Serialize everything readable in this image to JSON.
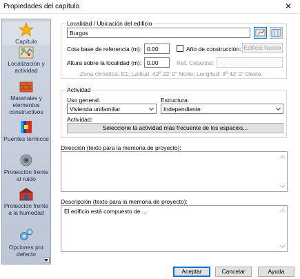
{
  "window": {
    "title": "Propiedades del capítulo",
    "close_symbol": "✕"
  },
  "sidebar": {
    "items": [
      {
        "label": "Capítulo",
        "icon": "star-icon"
      },
      {
        "label": "Localización y actividad",
        "icon": "map-icon"
      },
      {
        "label": "Materiales y elementos constructivos",
        "icon": "brick-icon"
      },
      {
        "label": "Puentes térmicos",
        "icon": "thermal-bridge-icon"
      },
      {
        "label": "Protección frente al ruido",
        "icon": "speaker-icon"
      },
      {
        "label": "Protección frente a la humedad",
        "icon": "humidity-icon"
      },
      {
        "label": "Opciones por defecto",
        "icon": "gears-icon"
      }
    ]
  },
  "location": {
    "legend": "Localidad / Ubicación del edificio",
    "city_value": "Burgos",
    "base_level_label": "Cota base de referencia (m):",
    "base_level_value": "0.00",
    "construction_year_label": "Año de construcción:",
    "new_building_label": "Edificio Nuevo",
    "height_label": "Altura sobre la localidad (m):",
    "height_value": "0.00",
    "cadastral_label": "Ref. Catastral:",
    "cadastral_value": "",
    "climate_info": "Zona climática: E1; Latitud: 42º 22' 0\" Norte; Longitud: 3º 42' 0\" Oeste"
  },
  "activity": {
    "legend": "Actividad",
    "general_use_label": "Uso general:",
    "general_use_value": "Vivienda unifamiliar",
    "structure_label": "Estructura:",
    "structure_value": "Independiente",
    "activity_label": "Actividad:",
    "select_activity_button": "Seleccione la actividad más frecuente de los espacios..."
  },
  "direction": {
    "label": "Dirección (texto para la memoria de proyecto):",
    "value": ""
  },
  "description": {
    "label": "Descripción (texto para la memoria de proyecto):",
    "value": "El edificio está compuesto de ..."
  },
  "footer": {
    "accept": "Aceptar",
    "cancel": "Cancelar",
    "help": "Ayuda"
  },
  "colors": {
    "sidebar_bg": "#c6cedb",
    "accent": "#0078d7"
  }
}
